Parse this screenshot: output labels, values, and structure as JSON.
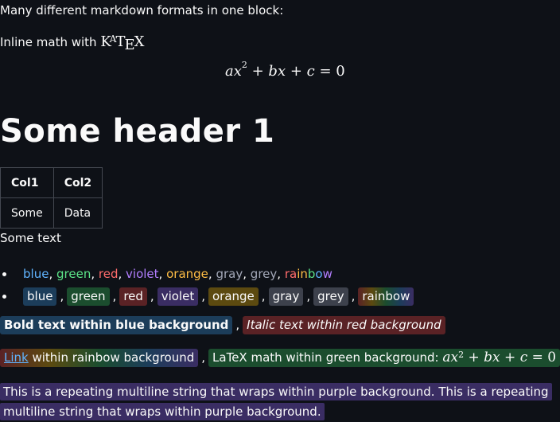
{
  "intro": "Many different markdown formats in one block:",
  "inline_math_label": "Inline math with",
  "katex_logo": {
    "k": "K",
    "a": "A",
    "t": "T",
    "e": "E",
    "x": "X"
  },
  "display_math": {
    "a": "ax",
    "sq": "2",
    "plus1": " + ",
    "b": "bx",
    "plus2": " + ",
    "c": "c",
    "eq": " = ",
    "zero": "0"
  },
  "header": "Some header 1",
  "table": {
    "headers": [
      "Col1",
      "Col2"
    ],
    "rows": [
      [
        "Some",
        "Data"
      ]
    ]
  },
  "some_text": "Some text",
  "colored_words": {
    "blue": "blue",
    "green": "green",
    "red": "red",
    "violet": "violet",
    "orange": "orange",
    "gray": "gray",
    "grey": "grey",
    "rainbow": [
      "ra",
      "in",
      "b",
      "o",
      "w"
    ]
  },
  "separator": ",",
  "bg_words": {
    "blue": "blue",
    "green": "green",
    "red": "red",
    "violet": "violet",
    "orange": "orange",
    "gray": "gray",
    "grey": "grey",
    "rainbow": "rainbow"
  },
  "bold_blue": "Bold text within blue background",
  "italic_red": "Italic text within red background",
  "link_text": "Link",
  "rainbow_suffix": " within rainbow background",
  "green_latex_label": "LaTeX math within green background:",
  "multiline": "This is a repeating multiline string that wraps within purple background. This is a repeating multiline string that wraps within purple background.",
  "colors": {
    "background": "#0e1117",
    "text": "#fafafa",
    "blue": "#60b4ff",
    "green": "#5ce488",
    "red": "#ff6c6c",
    "violet": "#b27eff",
    "orange": "#ffbd45",
    "gray": "#a3a8b8"
  }
}
